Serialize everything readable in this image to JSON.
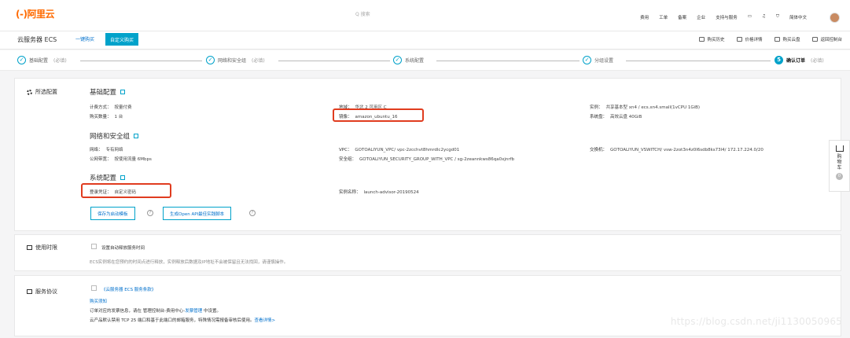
{
  "topnav": {
    "logo": "(-)阿里云",
    "search_placeholder": "Q 搜索",
    "items": [
      "费用",
      "工单",
      "备案",
      "企业",
      "支持与服务",
      "▭",
      "♫",
      "⛉",
      "简体中文"
    ]
  },
  "subnav": {
    "product": "云服务器 ECS",
    "tab_quick": "一键购买",
    "tab_custom": "自定义购买",
    "tools": [
      "购买历史",
      "价格详情",
      "购买云盘",
      "返回控制台"
    ]
  },
  "steps": [
    {
      "label": "基础配置",
      "req": "(必填)"
    },
    {
      "label": "网络和安全组",
      "req": "(必填)"
    },
    {
      "label": "系统配置",
      "req": ""
    },
    {
      "label": "分组设置",
      "req": ""
    },
    {
      "number": "5",
      "label": "确认订单",
      "req": "(必填)"
    }
  ],
  "selected": {
    "title": "所选配置",
    "basic": {
      "section": "基础配置",
      "billing_label": "计费方式：",
      "billing_value": "按量付费",
      "region_label": "地域：",
      "region_value": "华北 2 可用区 C",
      "instance_label": "实例：",
      "instance_value": "共享基本型 xn4 / ecs.xn4.small(1vCPU 1GiB)",
      "qty_label": "购买数量：",
      "qty_value": "1 台",
      "image_label": "镜像：",
      "image_value": "amazon_ubuntu_16",
      "disk_label": "系统盘：",
      "disk_value": "高效云盘 40GiB"
    },
    "network": {
      "section": "网络和安全组",
      "net_label": "网络：",
      "net_value": "专有网络",
      "vpc_label": "VPC：",
      "vpc_value": "GOTOALIYUN_VPC/ vpc-2zcchvt8hmrdlc2ycgd01",
      "vsw_label": "交换机：",
      "vsw_value": "GOTOALIYUN_VSWITCH/ vsw-2zot3n4z0l6sdb8ks73l4/ 172.17.224.0/20",
      "bw_label": "公网带宽：",
      "bw_value": "按使用流量 6Mbps",
      "sg_label": "安全组：",
      "sg_value": "GOTOALIYUN_SECURITY_GROUP_WITH_VPC / sg-2zeannkws86qa0xjnrfb"
    },
    "system": {
      "section": "系统配置",
      "login_label": "登录凭证：",
      "login_value": "自定义密码",
      "name_label": "实例名称：",
      "name_value": "launch-advisor-20190524"
    },
    "buttons": {
      "save_template": "保存为启动模板",
      "gen_api": "生成Open API最佳实践脚本"
    }
  },
  "usage": {
    "title": "使用时限",
    "checkbox_label": "设置自动释放服务时间",
    "note": "ECS实例将在您预约的时间点进行释放，实例释放后数据及IP地址不会被保留且无法找回，请谨慎操作。"
  },
  "agreement": {
    "title": "服务协议",
    "checkbox_label": "《云服务器 ECS 服务条款》",
    "notice_title": "购买须知",
    "line1_a": "订单对应的发票信息，请在 管理控制台-费用中心-",
    "line1_link": "发票管理",
    "line1_b": " 中设置。",
    "line2_a": "云产品默认禁用 TCP 25 端口和基于此端口的邮箱服务，特殊情况需报备审核后使用。",
    "line2_link": "查看详情>"
  },
  "cart": {
    "label": "购物车",
    "count": "0"
  },
  "watermark": "https://blog.csdn.net/ji1130050965"
}
